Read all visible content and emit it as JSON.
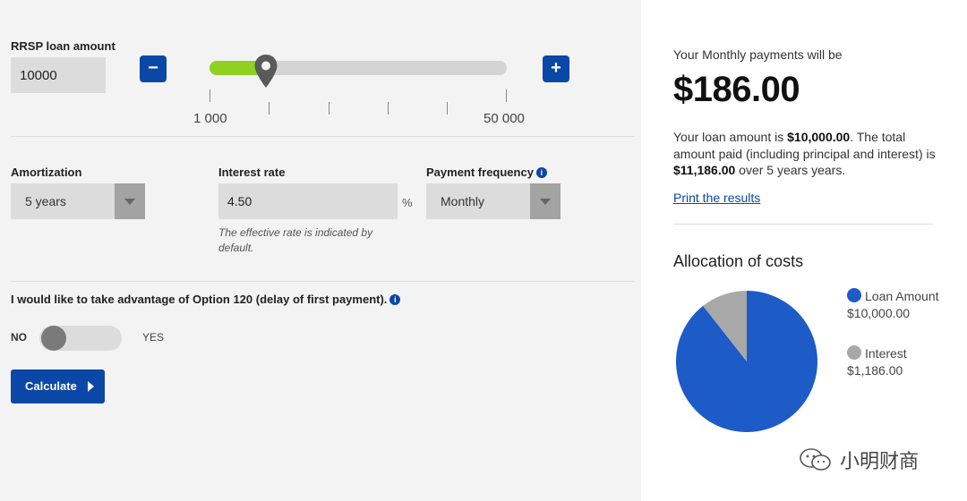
{
  "loan": {
    "label": "RRSP loan amount",
    "value": "10000",
    "minus_label": "−",
    "plus_label": "+",
    "slider_fraction": 0.19,
    "range_min_label": "1 000",
    "range_max_label": "50 000"
  },
  "amortization": {
    "label": "Amortization",
    "selected": "5 years"
  },
  "interest": {
    "label": "Interest rate",
    "value": "4.50",
    "unit": "%",
    "hint": "The effective rate is indicated by default."
  },
  "frequency": {
    "label": "Payment frequency",
    "selected": "Monthly"
  },
  "option120": {
    "label": "I would like to take advantage of Option 120 (delay of first payment).",
    "no_label": "NO",
    "yes_label": "YES",
    "enabled": false
  },
  "calculate_label": "Calculate",
  "info_glyph": "i",
  "results": {
    "intro": "Your Monthly payments will be",
    "monthly_amount": "$186.00",
    "summary_1": "Your loan amount is ",
    "loan_amount": "$10,000.00",
    "summary_2": ". The total amount paid (including principal and interest) is ",
    "total_paid": "$11,186.00",
    "summary_3": " over 5 years years.",
    "print_label": "Print the results",
    "allocation_title": "Allocation of costs"
  },
  "allocation": {
    "legend": [
      {
        "name": "Loan Amount",
        "value_label": "$10,000.00",
        "value": 10000,
        "color": "#1d5bc7"
      },
      {
        "name": "Interest",
        "value_label": "$1,186.00",
        "value": 1186,
        "color": "#a8a8a8"
      }
    ]
  },
  "watermark": "小明财商",
  "colors": {
    "primary": "#0b47a6",
    "slider_fill": "#8fd120",
    "panel_bg": "#f3f3f3"
  }
}
